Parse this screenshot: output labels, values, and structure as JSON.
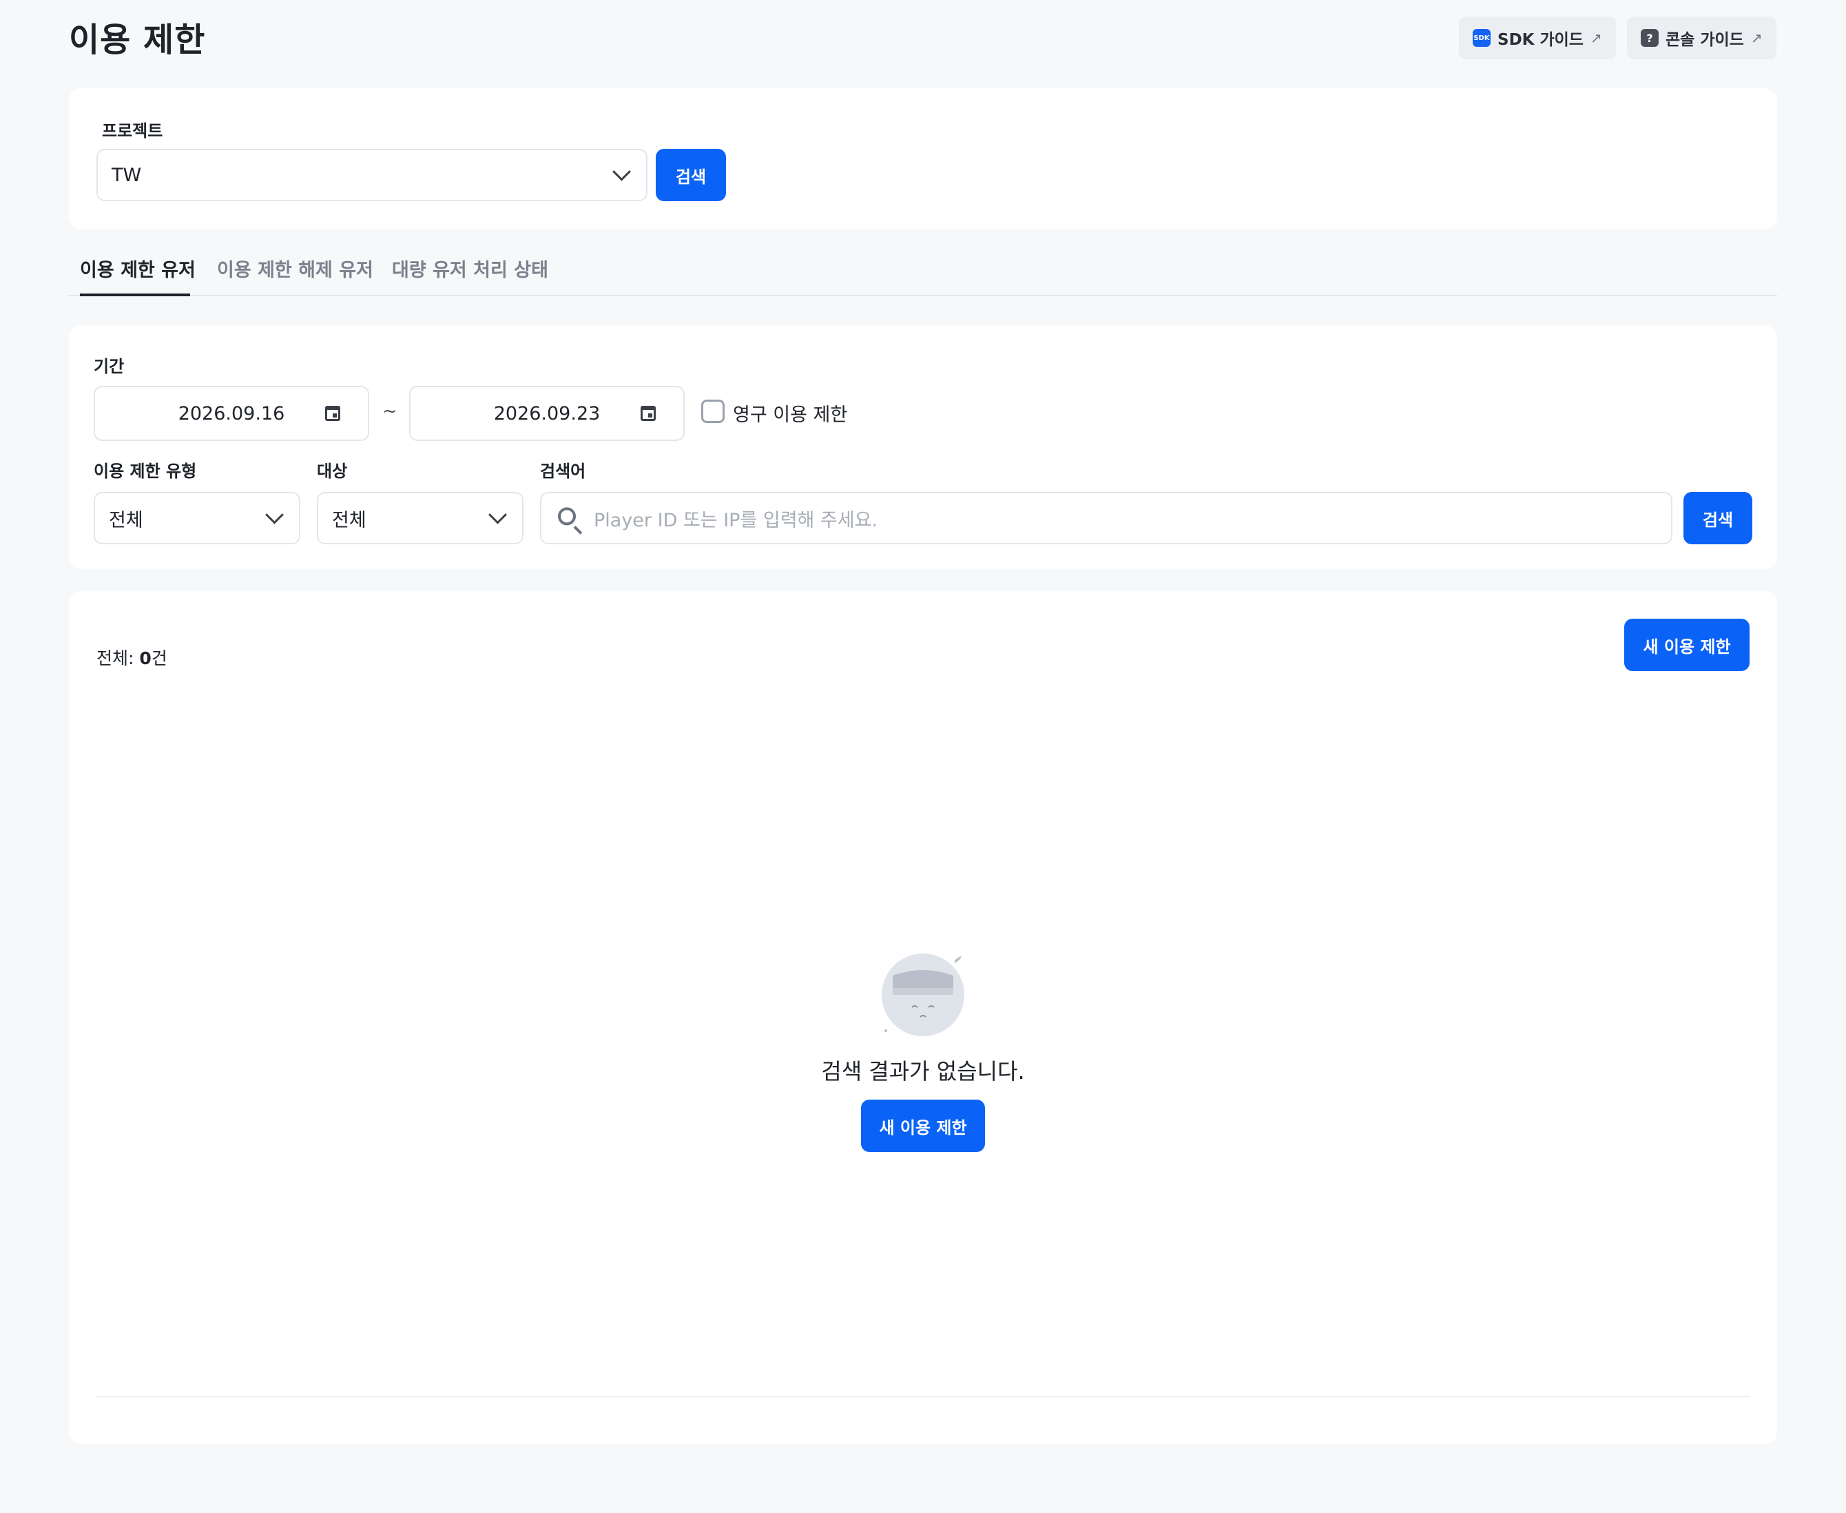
{
  "header": {
    "title": "이용 제한",
    "sdk_guide": {
      "icon_text": "SDK",
      "label": "SDK 가이드"
    },
    "console_guide": {
      "icon_text": "?",
      "label": "콘솔 가이드"
    }
  },
  "project": {
    "label": "프로젝트",
    "selected": "TW",
    "search_label": "검색"
  },
  "tabs": [
    {
      "label": "이용 제한 유저",
      "active": true
    },
    {
      "label": "이용 제한 해제 유저",
      "active": false
    },
    {
      "label": "대량 유저 처리 상태",
      "active": false
    }
  ],
  "filters": {
    "period_label": "기간",
    "start_date": "2026.09.16",
    "separator": "~",
    "end_date": "2026.09.23",
    "permanent_label": "영구 이용 제한",
    "type_label": "이용 제한 유형",
    "type_value": "전체",
    "target_label": "대상",
    "target_value": "전체",
    "keyword_label": "검색어",
    "keyword_placeholder": "Player ID 또는 IP를 입력해 주세요.",
    "search_label": "검색"
  },
  "results": {
    "total_prefix": "전체: ",
    "total_count": "0",
    "total_suffix": "건",
    "new_button": "새 이용 제한",
    "empty_message": "검색 결과가 없습니다.",
    "empty_button": "새 이용 제한"
  },
  "colors": {
    "primary": "#0a63f6",
    "background": "#f7f8fa",
    "card": "#ffffff"
  }
}
